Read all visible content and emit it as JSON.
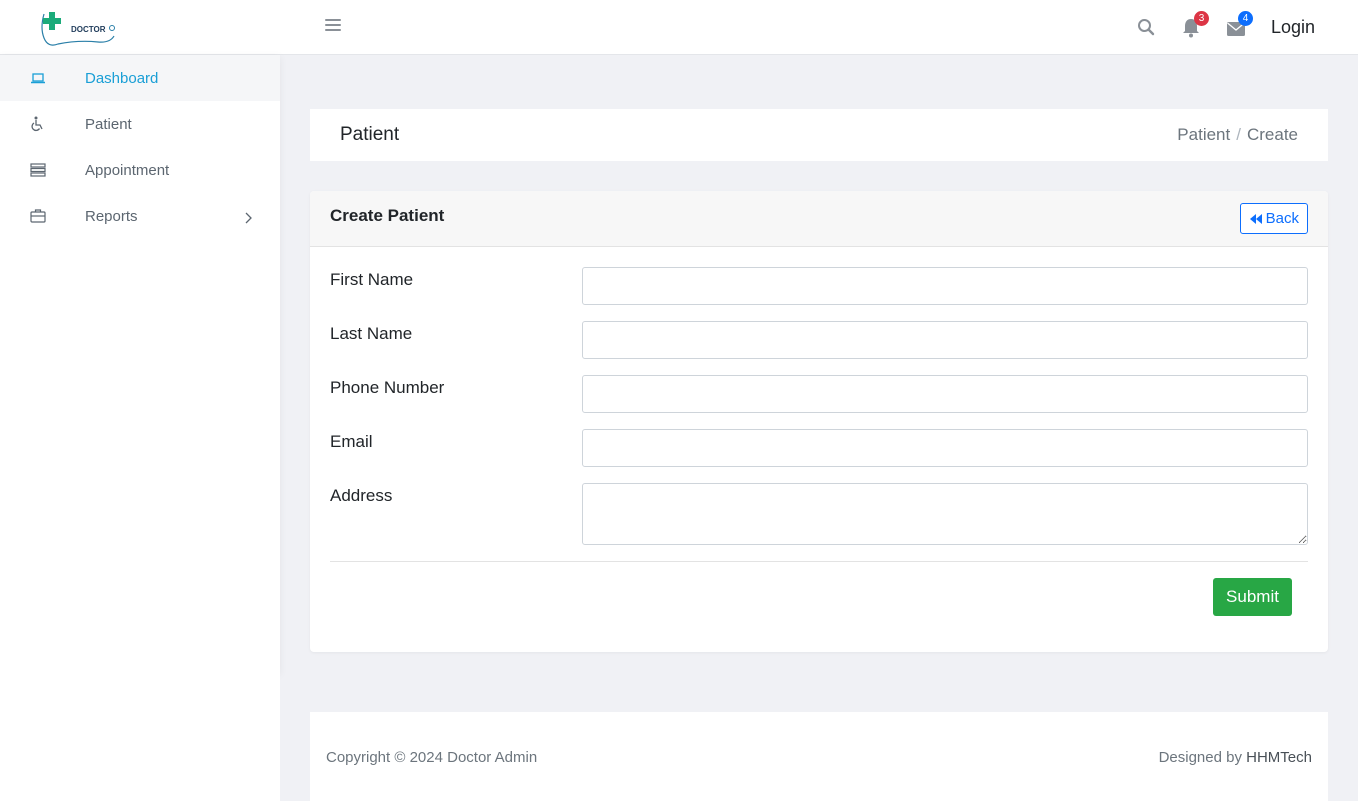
{
  "header": {
    "logo_text": "DOCTOR",
    "notifications_count": "3",
    "messages_count": "4",
    "login_label": "Login"
  },
  "sidebar": {
    "items": [
      {
        "label": "Dashboard",
        "icon": "laptop-icon"
      },
      {
        "label": "Patient",
        "icon": "wheelchair-icon"
      },
      {
        "label": "Appointment",
        "icon": "server-icon"
      },
      {
        "label": "Reports",
        "icon": "briefcase-icon"
      }
    ]
  },
  "page": {
    "title": "Patient",
    "breadcrumb": [
      "Patient",
      "Create"
    ]
  },
  "form": {
    "title": "Create Patient",
    "back_label": "Back",
    "fields": [
      {
        "label": "First Name",
        "value": ""
      },
      {
        "label": "Last Name",
        "value": ""
      },
      {
        "label": "Phone Number",
        "value": ""
      },
      {
        "label": "Email",
        "value": ""
      },
      {
        "label": "Address",
        "value": ""
      }
    ],
    "submit_label": "Submit"
  },
  "footer": {
    "copyright": "Copyright © 2024 Doctor Admin",
    "designed_by": "Designed by",
    "brand": "HHMTech"
  },
  "colors": {
    "accent": "#1a9fd6",
    "primary": "#0d6efd",
    "success": "#28a745",
    "danger": "#dc3545"
  }
}
